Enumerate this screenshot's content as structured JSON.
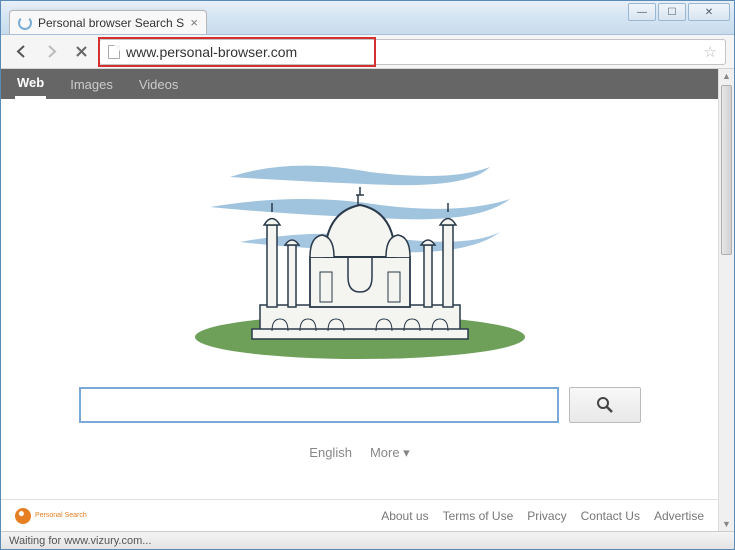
{
  "window": {
    "minimize": "—",
    "maximize": "☐",
    "close": "✕"
  },
  "tab": {
    "title": "Personal browser Search S",
    "close": "×"
  },
  "toolbar": {
    "url": "www.personal-browser.com"
  },
  "page": {
    "nav": {
      "web": "Web",
      "images": "Images",
      "videos": "Videos"
    },
    "lang": {
      "english": "English",
      "more": "More ▾"
    },
    "footer_logo": "Personal Search",
    "footer_links": {
      "about": "About us",
      "terms": "Terms of Use",
      "privacy": "Privacy",
      "contact": "Contact Us",
      "advertise": "Advertise"
    }
  },
  "status": "Waiting for www.vizury.com...",
  "colors": {
    "highlight": "#d43030",
    "accent": "#7aa8d8",
    "navbg": "#666666"
  }
}
